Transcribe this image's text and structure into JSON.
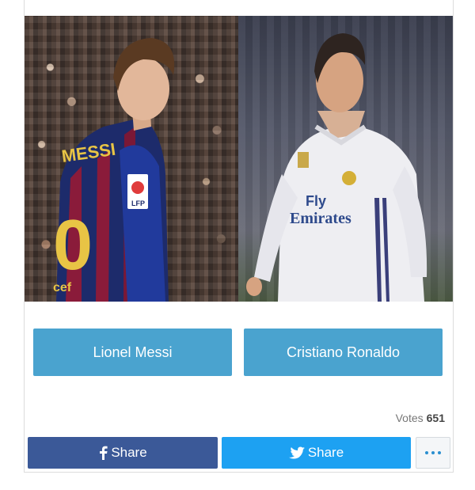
{
  "poll": {
    "options": [
      {
        "label": "Lionel Messi",
        "image": "messi-photo"
      },
      {
        "label": "Cristiano Ronaldo",
        "image": "ronaldo-photo"
      }
    ],
    "votes_label": "Votes",
    "votes_count": "651"
  },
  "jersey_text": {
    "messi_name": "MESSI",
    "messi_number": "0",
    "lfp": "LFP",
    "sponsor_left": "cef",
    "ronaldo_sponsor_line1": "Fly",
    "ronaldo_sponsor_line2": "Emirates"
  },
  "share": {
    "facebook_label": "Share",
    "twitter_label": "Share",
    "facebook_icon": "facebook-icon",
    "twitter_icon": "twitter-icon",
    "more_icon": "more-dots-icon"
  },
  "colors": {
    "vote_button": "#4aa3cf",
    "facebook": "#3b5998",
    "twitter": "#1da1f2"
  }
}
